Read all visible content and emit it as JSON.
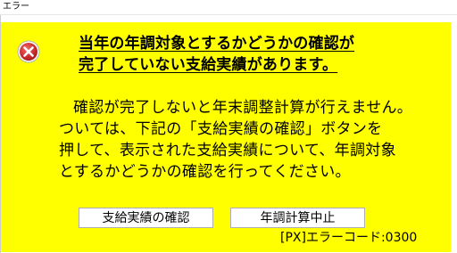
{
  "window": {
    "title": "エラー"
  },
  "dialog": {
    "icon": "error-icon",
    "heading_lines": [
      "当年の年調対象とするかどうかの確認が",
      "完了していない支給実績があります。"
    ],
    "message_lines": [
      "確認が完了しないと年末調整計算が行えません。",
      "ついては、下記の「支給実績の確認」ボタンを",
      "押して、表示された支給実績について、年調対象",
      "とするかどうかの確認を行ってください。"
    ],
    "buttons": {
      "confirm_label": "支給実績の確認",
      "cancel_label": "年調計算中止"
    },
    "error_code": "[PX]エラーコード:0300"
  },
  "colors": {
    "background": "#ffff00",
    "icon_red": "#d32f2f"
  }
}
